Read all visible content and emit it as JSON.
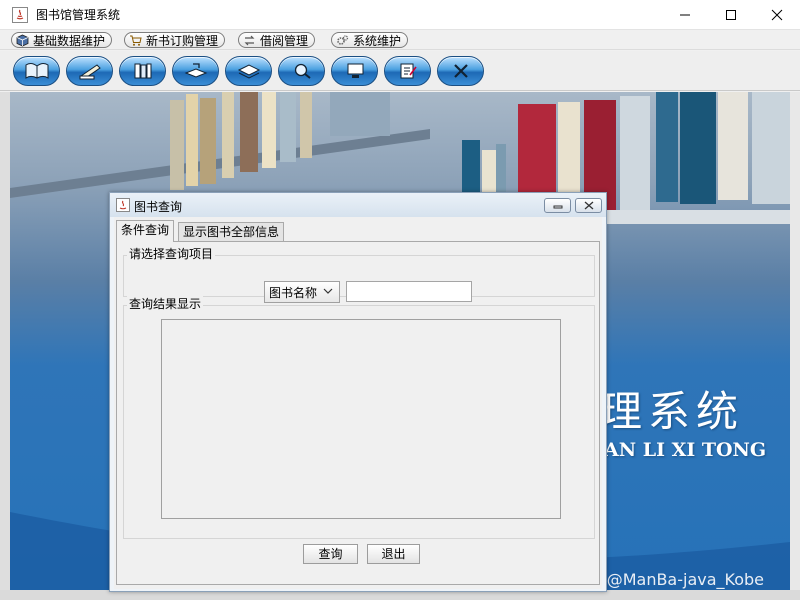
{
  "window": {
    "title": "图书馆管理系统"
  },
  "menubar": {
    "items": [
      {
        "label": "基础数据维护",
        "icon": "cube-icon"
      },
      {
        "label": "新书订购管理",
        "icon": "cart-icon"
      },
      {
        "label": "借阅管理",
        "icon": "exchange-icon"
      },
      {
        "label": "系统维护",
        "icon": "gears-icon"
      }
    ]
  },
  "toolbar": {
    "buttons": [
      {
        "icon": "open-book-icon"
      },
      {
        "icon": "pen-book-icon"
      },
      {
        "icon": "books-icon"
      },
      {
        "icon": "return-book-icon"
      },
      {
        "icon": "book-stack-icon"
      },
      {
        "icon": "search-icon"
      },
      {
        "icon": "monitor-icon"
      },
      {
        "icon": "edit-document-icon"
      },
      {
        "icon": "exit-icon"
      }
    ]
  },
  "background": {
    "slogan_cn": "理系统",
    "slogan_en": "AN LI XI TONG",
    "watermark": "CSDN @ManBa-java_Kobe"
  },
  "query_frame": {
    "title": "图书查询",
    "tabs": [
      {
        "label": "条件查询",
        "selected": true
      },
      {
        "label": "显示图书全部信息",
        "selected": false
      }
    ],
    "criteria_group": {
      "title": "请选择查询项目",
      "field_select": "图书名称",
      "search_value": ""
    },
    "result_group": {
      "title": "查询结果显示"
    },
    "buttons": {
      "query": "查询",
      "exit": "退出"
    }
  },
  "colors": {
    "toolbar_button": "#3b8ed6",
    "desktop_blue": "#2672b8"
  }
}
